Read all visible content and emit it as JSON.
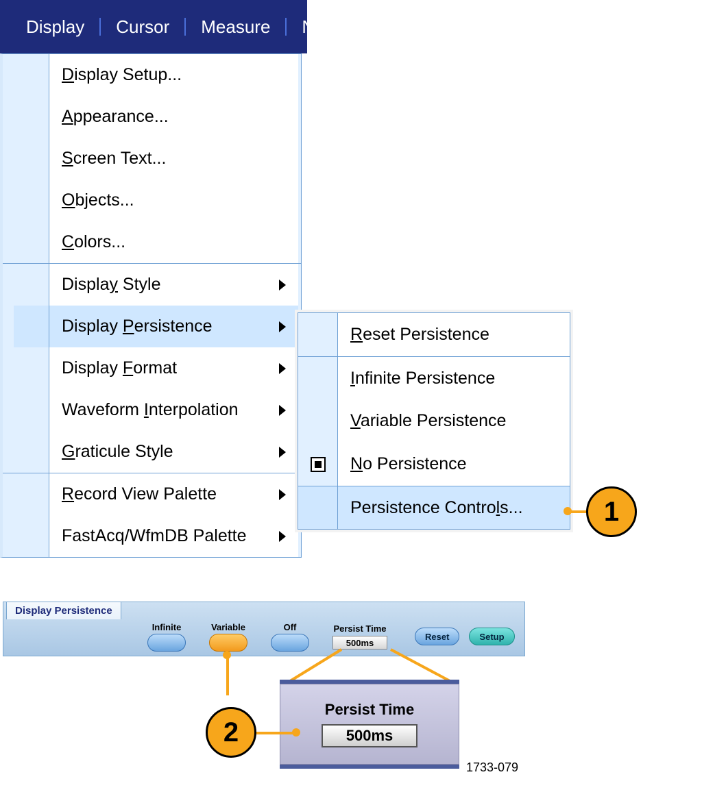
{
  "menubar": {
    "items": [
      "Display",
      "Cursor",
      "Measure",
      "N"
    ]
  },
  "dropdown": {
    "groups": [
      [
        {
          "label": "Display Setup...",
          "u": "D"
        },
        {
          "label": "Appearance...",
          "u": "A"
        },
        {
          "label": "Screen Text...",
          "u": "S"
        },
        {
          "label": "Objects...",
          "u": "O"
        },
        {
          "label": "Colors...",
          "u": "C"
        }
      ],
      [
        {
          "label": "Display Style",
          "u": "y",
          "sub": true
        },
        {
          "label": "Display Persistence",
          "u": "P",
          "sub": true,
          "highlight": true
        },
        {
          "label": "Display Format",
          "u": "F",
          "sub": true
        },
        {
          "label": "Waveform Interpolation",
          "u": "I",
          "sub": true
        },
        {
          "label": "Graticule Style",
          "u": "G",
          "sub": true
        }
      ],
      [
        {
          "label": "Record View Palette",
          "u": "R",
          "sub": true
        },
        {
          "label": "FastAcq/WfmDB Palette",
          "u": "",
          "sub": true
        }
      ]
    ]
  },
  "submenu": {
    "items": [
      {
        "label": "Reset Persistence",
        "u": "R"
      },
      {
        "label": "Infinite Persistence",
        "u": "I",
        "sep": true
      },
      {
        "label": "Variable Persistence",
        "u": "V"
      },
      {
        "label": "No Persistence",
        "u": "N",
        "checked": true
      },
      {
        "label": "Persistence Controls...",
        "u": "l",
        "sep": true,
        "highlight": true
      }
    ]
  },
  "panel": {
    "tab": "Display Persistence",
    "buttons": [
      {
        "label": "Infinite",
        "active": false
      },
      {
        "label": "Variable",
        "active": true
      },
      {
        "label": "Off",
        "active": false
      }
    ],
    "persist_time_label": "Persist Time",
    "persist_time_value": "500ms",
    "pills": [
      "Reset",
      "Setup"
    ]
  },
  "zoom": {
    "label": "Persist Time",
    "value": "500ms"
  },
  "callouts": {
    "c1": "1",
    "c2": "2"
  },
  "figref": "1733-079"
}
